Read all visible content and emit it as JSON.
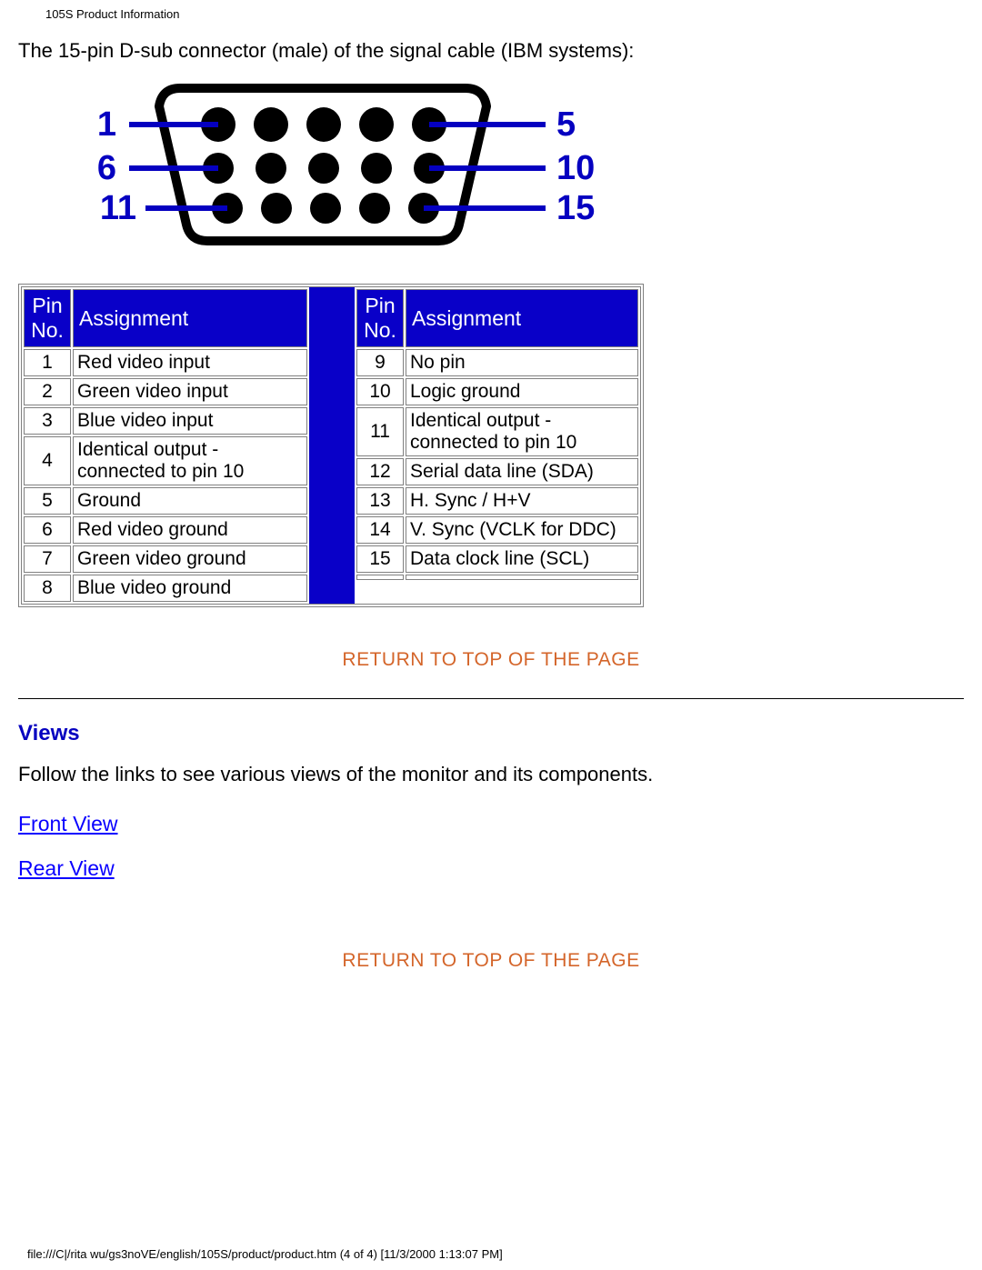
{
  "doc": {
    "title": "105S Product Information",
    "intro": "The 15-pin D-sub connector (male) of the signal cable (IBM systems):",
    "footer": "file:///C|/rita wu/gs3noVE/english/105S/product/product.htm (4 of 4) [11/3/2000 1:13:07 PM]"
  },
  "connector": {
    "left_labels": [
      "1",
      "6",
      "11"
    ],
    "right_labels": [
      "5",
      "10",
      "15"
    ]
  },
  "table": {
    "headers": {
      "pin": "Pin\nNo.",
      "assign": "Assignment"
    },
    "left": [
      {
        "pin": "1",
        "assign": "Red video input"
      },
      {
        "pin": "2",
        "assign": "Green video input"
      },
      {
        "pin": "3",
        "assign": "Blue video input"
      },
      {
        "pin": "4",
        "assign": "Identical output - connected to pin 10"
      },
      {
        "pin": "5",
        "assign": "Ground"
      },
      {
        "pin": "6",
        "assign": "Red video ground"
      },
      {
        "pin": "7",
        "assign": "Green video ground"
      },
      {
        "pin": "8",
        "assign": "Blue video ground"
      }
    ],
    "right": [
      {
        "pin": "9",
        "assign": "No pin"
      },
      {
        "pin": "10",
        "assign": "Logic ground"
      },
      {
        "pin": "11",
        "assign": "Identical output - connected to pin 10"
      },
      {
        "pin": "12",
        "assign": "Serial data line (SDA)"
      },
      {
        "pin": "13",
        "assign": "H. Sync / H+V"
      },
      {
        "pin": "14",
        "assign": "V. Sync (VCLK for DDC)"
      },
      {
        "pin": "15",
        "assign": "Data clock line (SCL)"
      },
      {
        "pin": "",
        "assign": ""
      }
    ]
  },
  "links": {
    "top": "RETURN TO TOP OF THE PAGE",
    "front": "Front View",
    "rear": "Rear View"
  },
  "sections": {
    "views_heading": "Views",
    "views_desc": "Follow the links to see various views of the monitor and its components."
  }
}
